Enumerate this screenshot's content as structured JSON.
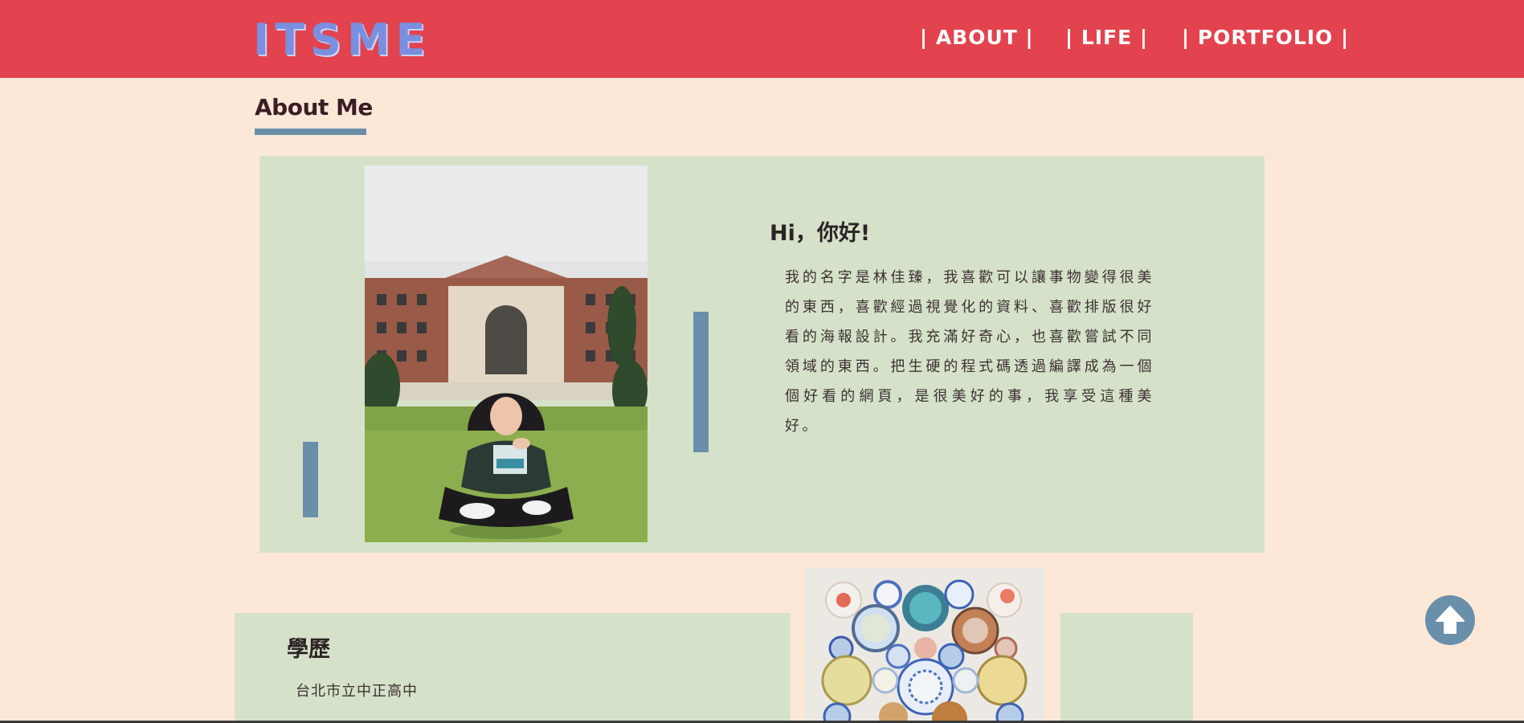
{
  "header": {
    "logo": "ITSME",
    "nav": [
      "| ABOUT |",
      "| LIFE |",
      "| PORTFOLIO |"
    ]
  },
  "about": {
    "section_title": "About Me",
    "greeting": "Hi，你好!",
    "bio": "我的名字是林佳臻，我喜歡可以讓事物變得很美的東西，喜歡經過視覺化的資料、喜歡排版很好看的海報設計。我充滿好奇心，也喜歡嘗試不同領域的東西。把生硬的程式碼透過編譯成為一個個好看的網頁，是很美好的事，我享受這種美好。"
  },
  "education": {
    "title": "學歷",
    "items": [
      "台北市立中正高中"
    ]
  },
  "icons": {
    "back_to_top": "arrow-up-icon"
  },
  "colors": {
    "header_bg": "#e2434e",
    "page_bg": "#fde8d7",
    "card_bg": "#d5e2c9",
    "accent": "#6a8fab",
    "logo": "#7a8fe0"
  }
}
